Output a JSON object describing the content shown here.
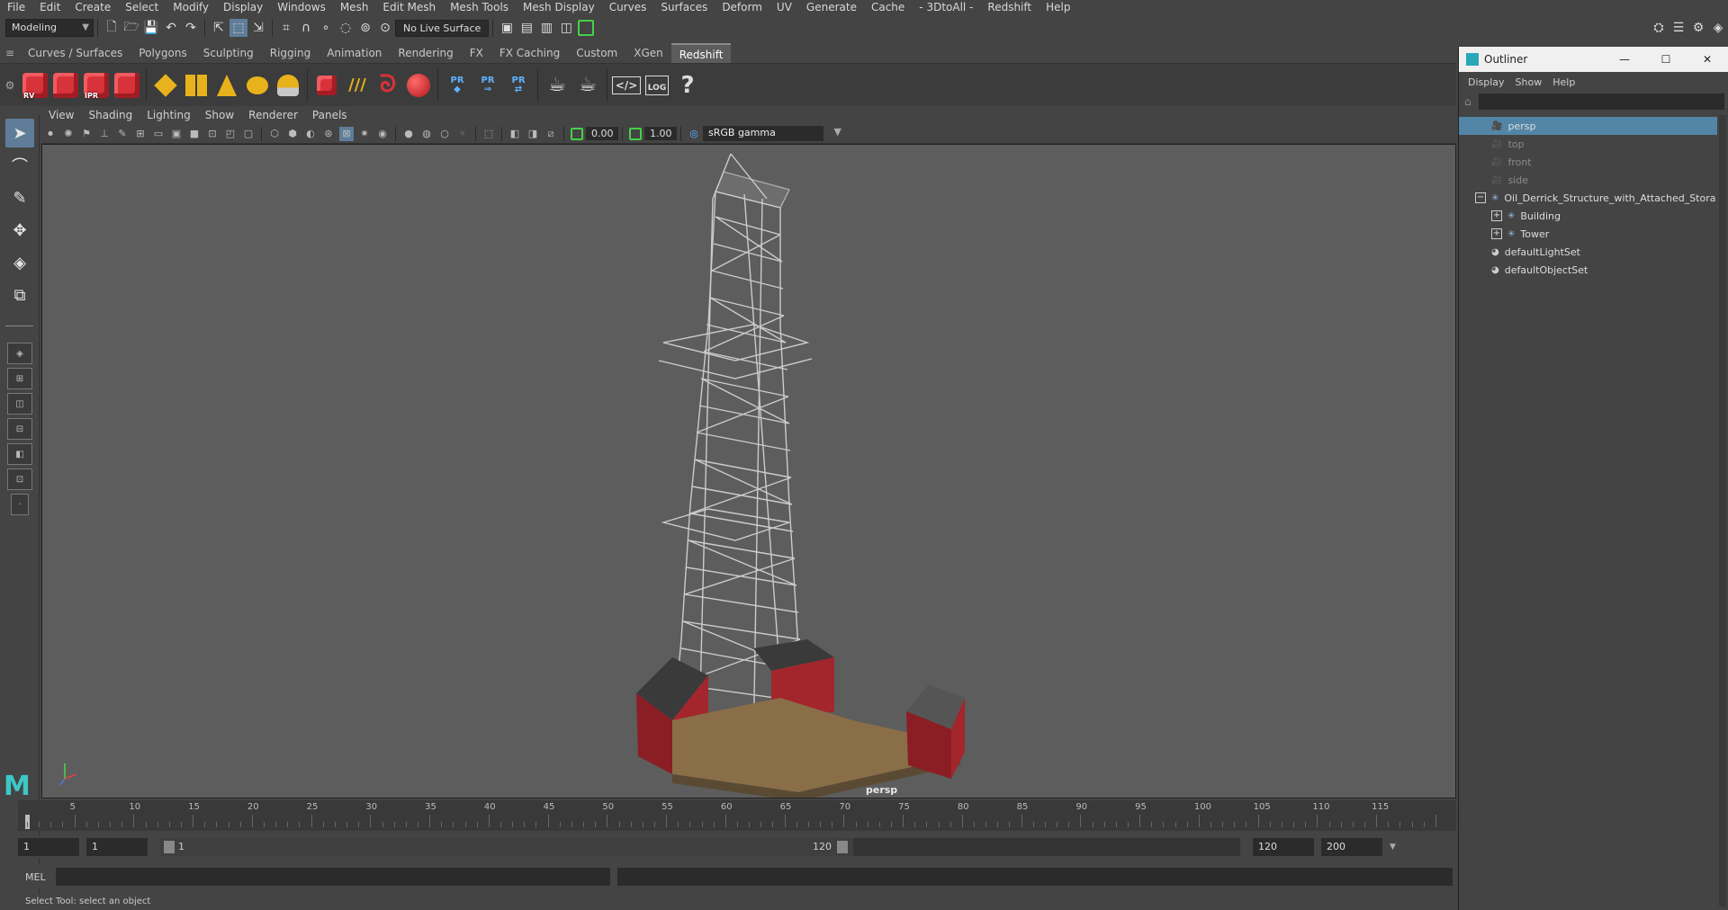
{
  "menubar": {
    "items": [
      "File",
      "Edit",
      "Create",
      "Select",
      "Modify",
      "Display",
      "Windows",
      "Mesh",
      "Edit Mesh",
      "Mesh Tools",
      "Mesh Display",
      "Curves",
      "Surfaces",
      "Deform",
      "UV",
      "Generate",
      "Cache",
      "- 3DtoAll -",
      "Redshift",
      "Help"
    ]
  },
  "statusline": {
    "mode": "Modeling",
    "live_surface": "No Live Surface"
  },
  "shelf": {
    "tabs": [
      "Curves / Surfaces",
      "Polygons",
      "Sculpting",
      "Rigging",
      "Animation",
      "Rendering",
      "FX",
      "FX Caching",
      "Custom",
      "XGen",
      "Redshift"
    ],
    "active_tab": "Redshift",
    "buttons": [
      {
        "name": "render-view",
        "sub": "RV"
      },
      {
        "name": "render-batch",
        "sub": ""
      },
      {
        "name": "render-ipr",
        "sub": "IPR"
      },
      {
        "name": "render-settings",
        "sub": ""
      }
    ],
    "pr_labels": [
      "PR",
      "PR",
      "PR"
    ],
    "log_label": "LOG",
    "help_label": "?"
  },
  "panel": {
    "menus": [
      "View",
      "Shading",
      "Lighting",
      "Show",
      "Renderer",
      "Panels"
    ],
    "exposure": "0.00",
    "gamma": "1.00",
    "color_space": "sRGB gamma"
  },
  "viewport": {
    "camera_label": "persp"
  },
  "timeslider": {
    "ticks": [
      5,
      10,
      15,
      20,
      25,
      30,
      35,
      40,
      45,
      50,
      55,
      60,
      65,
      70,
      75,
      80,
      85,
      90,
      95,
      100,
      105,
      110,
      115
    ],
    "current_frame": "1"
  },
  "range": {
    "start_time": "1",
    "playback_start": "1",
    "range_start": "1",
    "range_end": "120",
    "playback_end": "120",
    "end_time": "200"
  },
  "cmdline": {
    "language": "MEL"
  },
  "helpline": {
    "text": "Select Tool: select an object"
  },
  "outliner": {
    "title": "Outliner",
    "menus": [
      "Display",
      "Show",
      "Help"
    ],
    "items": [
      {
        "label": "persp",
        "type": "camera",
        "depth": 0,
        "selected": true,
        "dim": false
      },
      {
        "label": "top",
        "type": "camera",
        "depth": 0,
        "selected": false,
        "dim": true
      },
      {
        "label": "front",
        "type": "camera",
        "depth": 0,
        "selected": false,
        "dim": true
      },
      {
        "label": "side",
        "type": "camera",
        "depth": 0,
        "selected": false,
        "dim": true
      },
      {
        "label": "Oil_Derrick_Structure_with_Attached_Stora",
        "type": "group",
        "depth": 0,
        "selected": false,
        "dim": false,
        "expand": "−"
      },
      {
        "label": "Building",
        "type": "group",
        "depth": 1,
        "selected": false,
        "dim": false,
        "expand": "+"
      },
      {
        "label": "Tower",
        "type": "group",
        "depth": 1,
        "selected": false,
        "dim": false,
        "expand": "+"
      },
      {
        "label": "defaultLightSet",
        "type": "set",
        "depth": 0,
        "selected": false,
        "dim": false
      },
      {
        "label": "defaultObjectSet",
        "type": "set",
        "depth": 0,
        "selected": false,
        "dim": false
      }
    ]
  },
  "colors": {
    "selection": "#5285a6",
    "shelf_red": "#d8323a",
    "shelf_yellow": "#e8b21c",
    "pr_blue": "#5fb2ff",
    "highlight_green": "#45d145"
  }
}
